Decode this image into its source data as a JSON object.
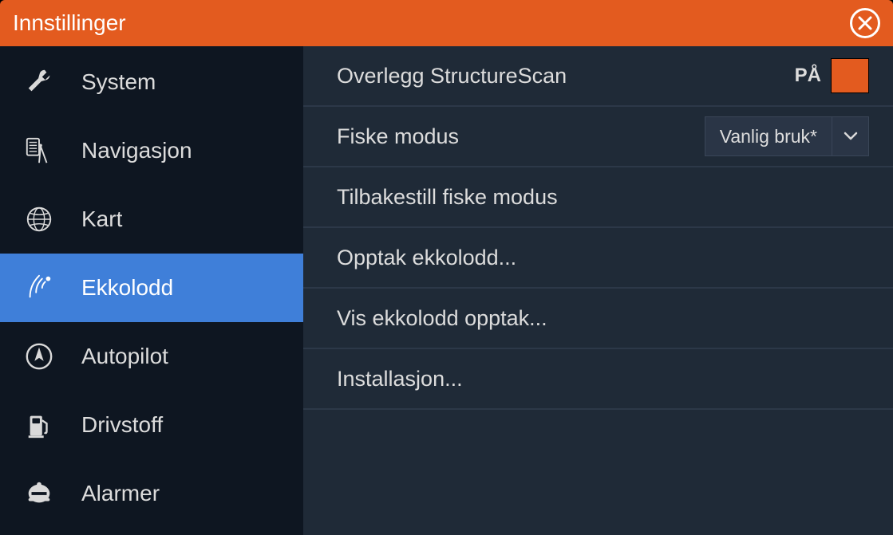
{
  "header": {
    "title": "Innstillinger"
  },
  "sidebar": {
    "items": [
      {
        "label": "System",
        "icon": "wrench"
      },
      {
        "label": "Navigasjon",
        "icon": "compass-calc"
      },
      {
        "label": "Kart",
        "icon": "globe"
      },
      {
        "label": "Ekkolodd",
        "icon": "signal"
      },
      {
        "label": "Autopilot",
        "icon": "nav-arrow"
      },
      {
        "label": "Drivstoff",
        "icon": "fuel"
      },
      {
        "label": "Alarmer",
        "icon": "bell"
      }
    ],
    "active_index": 3
  },
  "content": {
    "rows": [
      {
        "label": "Overlegg StructureScan",
        "control": "toggle",
        "toggle_label": "PÅ",
        "toggle_state": true
      },
      {
        "label": "Fiske modus",
        "control": "dropdown",
        "dropdown_value": "Vanlig bruk*"
      },
      {
        "label": "Tilbakestill fiske modus",
        "control": "none"
      },
      {
        "label": "Opptak ekkolodd...",
        "control": "none"
      },
      {
        "label": "Vis ekkolodd opptak...",
        "control": "none"
      },
      {
        "label": "Installasjon...",
        "control": "none"
      }
    ]
  }
}
